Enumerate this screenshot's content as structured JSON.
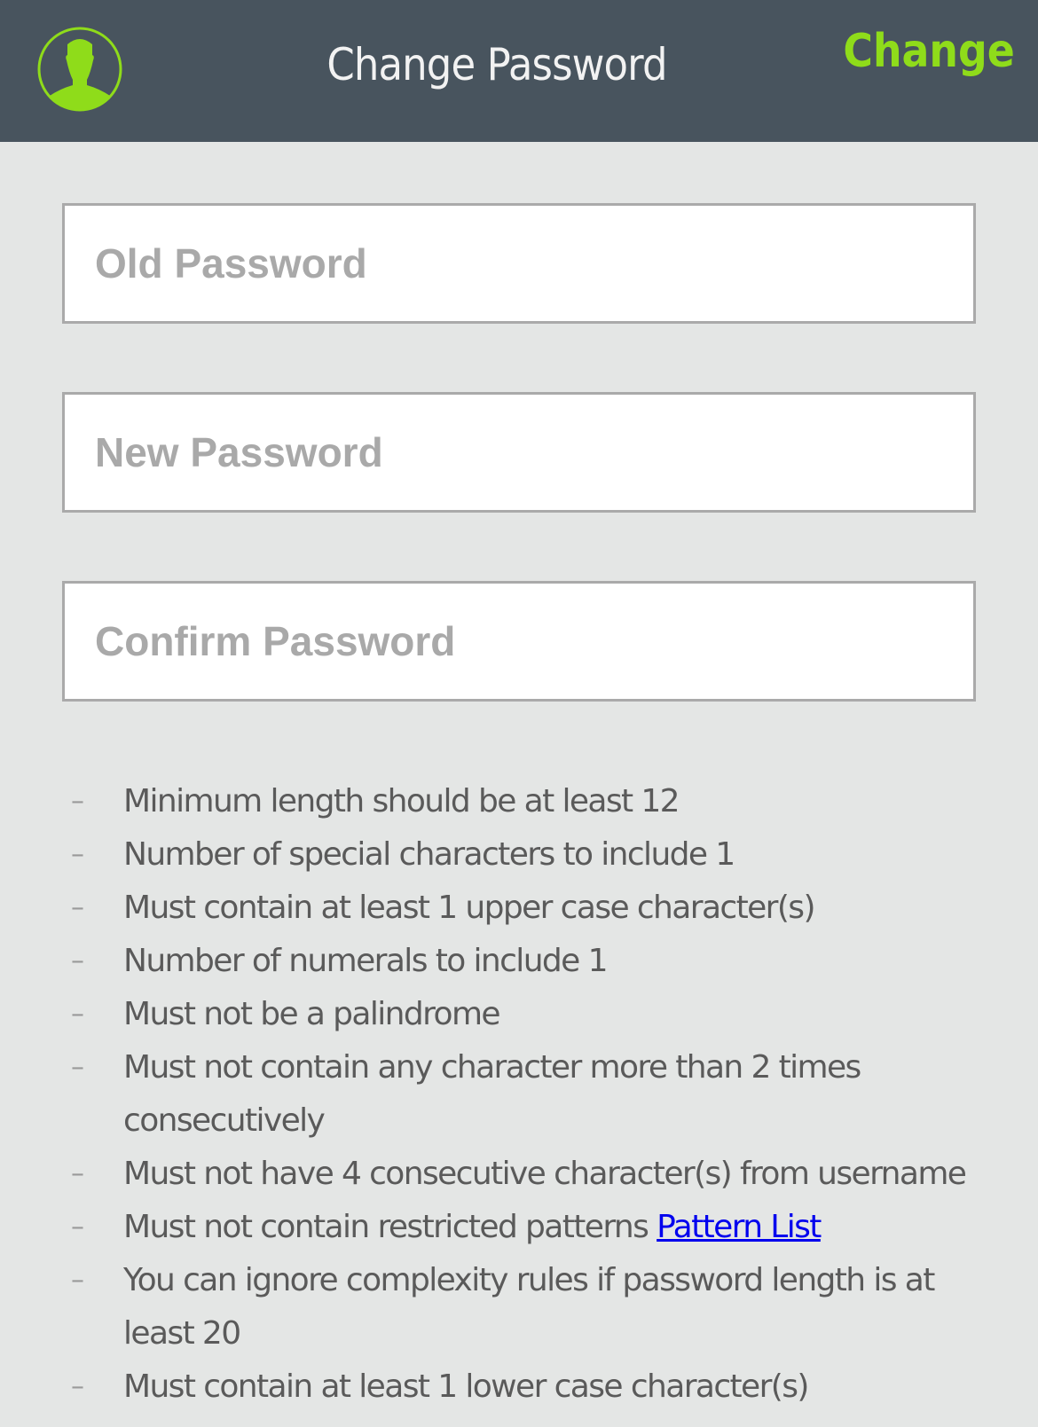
{
  "header": {
    "title": "Change Password",
    "action_label": "Change",
    "avatar_icon": "user-silhouette-icon",
    "accent_color": "#8fdc1a",
    "background_color": "#48545e"
  },
  "form": {
    "old_password": {
      "placeholder": "Old Password",
      "value": ""
    },
    "new_password": {
      "placeholder": "New Password",
      "value": ""
    },
    "confirm_password": {
      "placeholder": "Confirm Password",
      "value": ""
    }
  },
  "rules": [
    {
      "text": "Minimum length should be at least 12"
    },
    {
      "text": "Number of special characters to include 1"
    },
    {
      "text": "Must contain at least 1 upper case character(s)"
    },
    {
      "text": "Number of numerals to include 1"
    },
    {
      "text": "Must not be a palindrome"
    },
    {
      "text": "Must not contain any character more than 2 times consecutively"
    },
    {
      "text": "Must not have 4 consecutive character(s) from username"
    },
    {
      "text": "Must not contain restricted patterns ",
      "link": "Pattern List"
    },
    {
      "text": "You can ignore complexity rules if password length is at least 20"
    },
    {
      "text": "Must contain at least 1 lower case character(s)"
    }
  ],
  "bullet_glyph": "–"
}
